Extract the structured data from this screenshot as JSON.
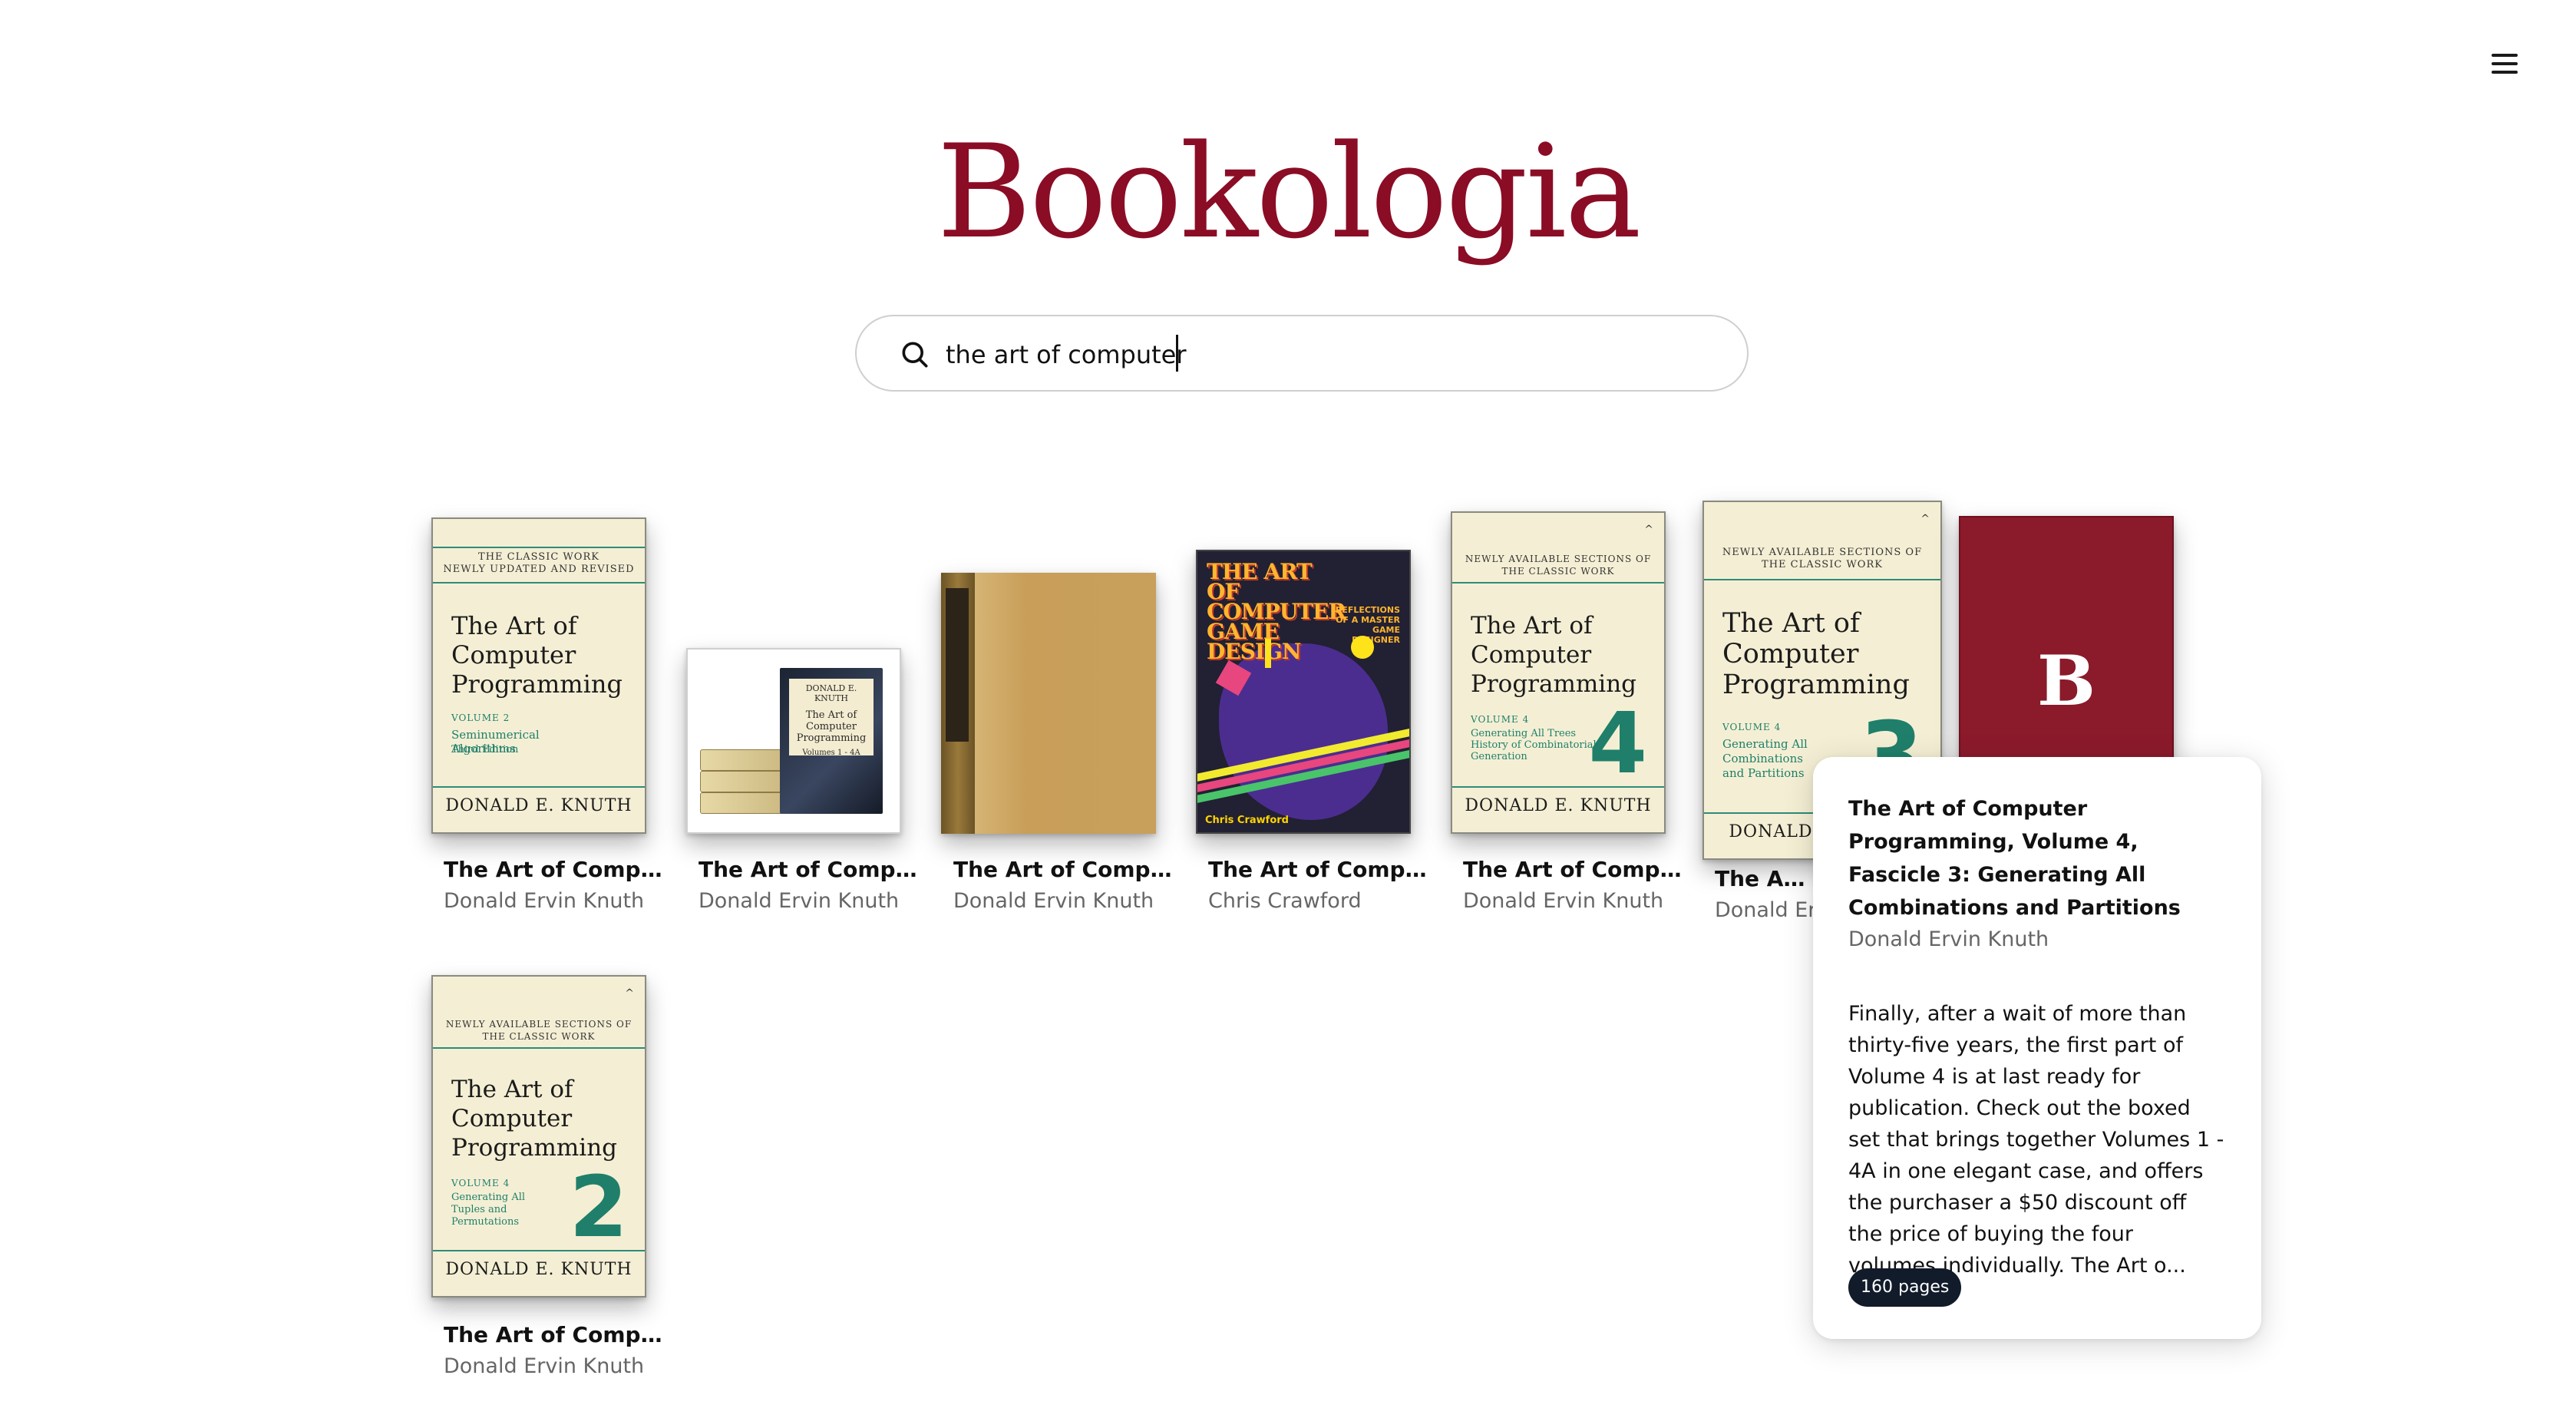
{
  "app": {
    "logo": "Bookologia",
    "menu_icon": "hamburger-menu-icon"
  },
  "search": {
    "icon": "search-icon",
    "value": "the art of computer "
  },
  "results": [
    {
      "title": "The Art of Computer ...",
      "author": "Donald Ervin Knuth",
      "cover": {
        "top": "THE CLASSIC WORK\nNEWLY UPDATED AND REVISED",
        "title": "The Art of Computer Programming",
        "volume": "VOLUME 2",
        "subtitle": "Seminumerical Algorithms",
        "edition": "Third Edition",
        "author": "DONALD E. KNUTH"
      }
    },
    {
      "title": "The Art of Computer ...",
      "author": "Donald Ervin Knuth",
      "cover": {
        "label_author": "DONALD E. KNUTH",
        "label_title": "The Art of Computer Programming",
        "label_vol": "Volumes 1 - 4A"
      }
    },
    {
      "title": "The Art of Computer ...",
      "author": "Donald Ervin Knuth"
    },
    {
      "title": "The Art of Computer ...",
      "author": "Chris Crawford",
      "cover": {
        "title": "THE ART OF COMPUTER GAME DESIGN",
        "subtitle": "REFLECTIONS OF A MASTER GAME DESIGNER",
        "author": "Chris Crawford"
      }
    },
    {
      "title": "The Art of Computer ...",
      "author": "Donald Ervin Knuth",
      "cover": {
        "top": "NEWLY AVAILABLE SECTIONS OF\nTHE CLASSIC WORK",
        "title": "The Art of Computer Programming",
        "volume": "VOLUME 4",
        "subtitle": "Generating All Trees\nHistory of Combinatorial Generation",
        "number": "4",
        "author": "DONALD E. KNUTH"
      }
    },
    {
      "title": "The Art of Computer ...",
      "author": "Donald Ervin Knuth",
      "cover": {
        "top": "NEWLY AVAILABLE SECTIONS OF\nTHE CLASSIC WORK",
        "title": "The Art of Computer Programming",
        "volume": "VOLUME 4",
        "subtitle": "Generating All Combinations and Partitions",
        "number": "3",
        "author": "DONALD E. KNUTH"
      }
    },
    {
      "title": "",
      "author": "",
      "cover": {
        "letter": "B"
      }
    },
    {
      "title": "The Art of Computer ...",
      "author": "Donald Ervin Knuth",
      "cover": {
        "top": "NEWLY AVAILABLE SECTIONS OF\nTHE CLASSIC WORK",
        "title": "The Art of Computer Programming",
        "volume": "VOLUME 4",
        "subtitle": "Generating All Tuples and Permutations",
        "number": "2",
        "author": "DONALD E. KNUTH"
      }
    }
  ],
  "popover": {
    "title": "The Art of Computer Programming, Volume 4, Fascicle 3: Generating All Combinations and Partitions",
    "author": "Donald Ervin Knuth",
    "description": "Finally, after a wait of more than thirty-five years, the first part of Volume 4 is at last ready for publication. Check out the boxed set that brings together Volumes 1 - 4A in one elegant case, and offers the purchaser a $50 discount off the price of buying the four volumes individually. The Art o...",
    "pages_badge": "160 pages"
  },
  "colors": {
    "brand": "#8b0c25",
    "badge_bg": "#111b2a"
  }
}
